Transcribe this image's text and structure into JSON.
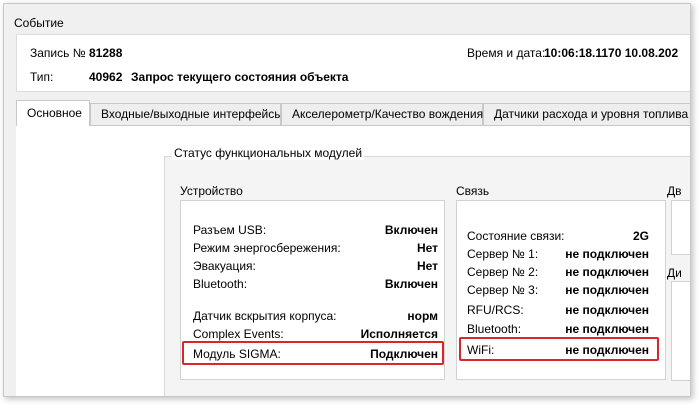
{
  "window": {
    "title": "Событие"
  },
  "header": {
    "record_label": "Запись №",
    "record_number": "81288",
    "datetime_label": "Время и дата:",
    "datetime_value": "10:06:18.1170 10.08.202",
    "type_label": "Тип:",
    "type_code": "40962",
    "type_name": "Запрос текущего состояния объекта"
  },
  "tabs": [
    {
      "label": "Основное"
    },
    {
      "label": "Входные/выходные интерфейсы"
    },
    {
      "label": "Акселерометр/Качество вождения"
    },
    {
      "label": "Датчики расхода и уровня топлива"
    }
  ],
  "status": {
    "caption": "Статус функциональных модулей",
    "device": {
      "caption": "Устройство",
      "rows": [
        {
          "label": "Разъем USB:",
          "value": "Включен"
        },
        {
          "label": "Режим энергосбережения:",
          "value": "Нет"
        },
        {
          "label": "Эвакуация:",
          "value": "Нет"
        },
        {
          "label": "Bluetooth:",
          "value": "Включен"
        },
        {
          "label": "Датчик вскрытия корпуса:",
          "value": "норм"
        },
        {
          "label": "Complex Events:",
          "value": "Исполняется"
        },
        {
          "label": "Модуль SIGMA:",
          "value": "Подключен"
        }
      ]
    },
    "link": {
      "caption": "Связь",
      "rows": [
        {
          "label": "Состояние связи:",
          "value": "2G"
        },
        {
          "label": "Сервер № 1:",
          "value": "не подключен"
        },
        {
          "label": "Сервер № 2:",
          "value": "не подключен"
        },
        {
          "label": "Сервер № 3:",
          "value": "не подключен"
        },
        {
          "label": "RFU/RCS:",
          "value": "не подключен"
        },
        {
          "label": "Bluetooth:",
          "value": "не подключен"
        },
        {
          "label": "WiFi:",
          "value": "не подключен"
        }
      ]
    },
    "cut_caption_1": "Дв",
    "cut_caption_2": "Ди"
  },
  "colors": {
    "highlight": "#d9262b"
  }
}
